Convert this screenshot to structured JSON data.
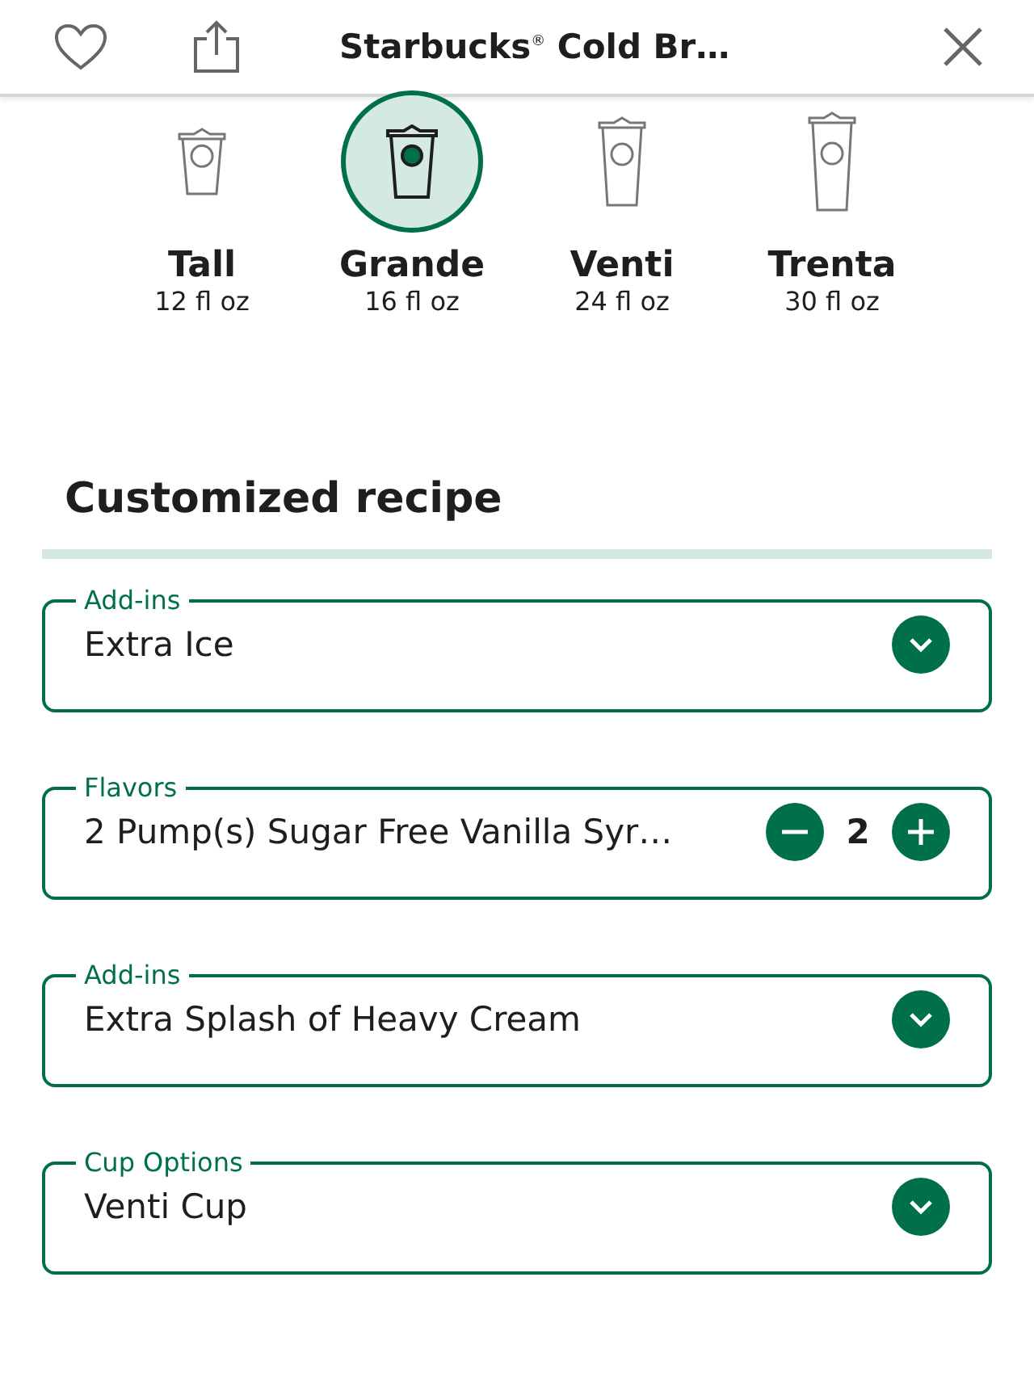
{
  "header": {
    "title": "Starbucks$^{®}$ Cold Br…"
  },
  "sizes": [
    {
      "name": "Tall",
      "volume": "12 fl oz",
      "selected": false
    },
    {
      "name": "Grande",
      "volume": "16 fl oz",
      "selected": true
    },
    {
      "name": "Venti",
      "volume": "24 fl oz",
      "selected": false
    },
    {
      "name": "Trenta",
      "volume": "30 fl oz",
      "selected": false
    }
  ],
  "section_title": "Customized recipe",
  "options": [
    {
      "kind": "select",
      "label": "Add-ins",
      "value": "Extra Ice"
    },
    {
      "kind": "stepper",
      "label": "Flavors",
      "value": "2 Pump(s) Sugar Free Vanilla Syr…",
      "quantity": "2"
    },
    {
      "kind": "select",
      "label": "Add-ins",
      "value": "Extra Splash of Heavy Cream"
    },
    {
      "kind": "select",
      "label": "Cup Options",
      "value": "Venti Cup"
    }
  ]
}
